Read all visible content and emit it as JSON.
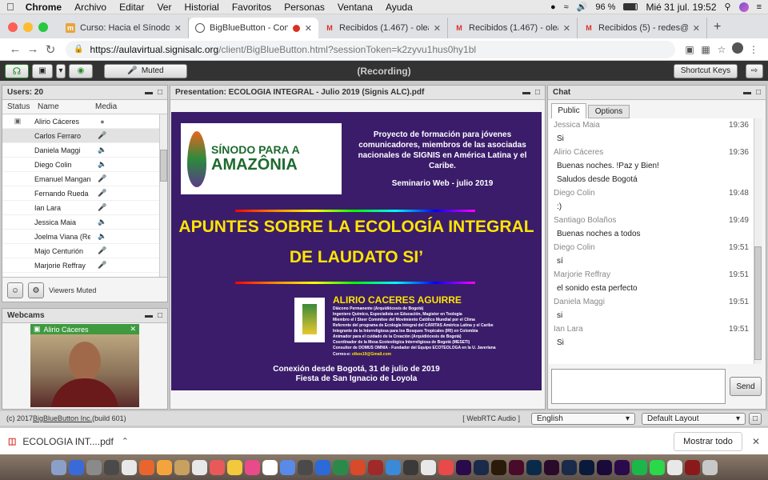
{
  "macmenu": {
    "app": "Chrome",
    "items": [
      "Archivo",
      "Editar",
      "Ver",
      "Historial",
      "Favoritos",
      "Personas",
      "Ventana",
      "Ayuda"
    ],
    "battery": "96 %",
    "clock": "Mié 31 jul.  19:52"
  },
  "tabs": [
    {
      "label": "Curso: Hacia el Sínodo Pana",
      "icon_color": "#e8a43c",
      "icon": "course-icon",
      "active": false
    },
    {
      "label": "BigBlueButton - Confere",
      "icon_color": "#555555",
      "icon": "globe-icon",
      "active": true,
      "recording": true
    },
    {
      "label": "Recibidos (1.467) - oleasc@",
      "icon_color": "#d93025",
      "icon": "gmail-icon",
      "active": false
    },
    {
      "label": "Recibidos (1.467) - oleasc@",
      "icon_color": "#d93025",
      "icon": "gmail-icon",
      "active": false
    },
    {
      "label": "Recibidos (5) - redes@signi",
      "icon_color": "#d93025",
      "icon": "gmail-icon",
      "active": false
    }
  ],
  "address": {
    "host": "https://aulavirtual.signisalc.org",
    "path": "/client/BigBlueButton.html?sessionToken=k2zyvu1hus0hy1bl"
  },
  "toolbar": {
    "muted_label": "Muted",
    "recording": "(Recording)",
    "shortcut_keys": "Shortcut Keys"
  },
  "users": {
    "title": "Users: 20",
    "columns": [
      "Status",
      "Name",
      "Media"
    ],
    "list": [
      {
        "name": "Alirio Cáceres",
        "media": "webcam",
        "selected": false,
        "presenter": true
      },
      {
        "name": "Carlos Ferraro",
        "media": "mic-off",
        "selected": true
      },
      {
        "name": "Daniela Maggi",
        "media": "speaker"
      },
      {
        "name": "Diego Colin",
        "media": "speaker"
      },
      {
        "name": "Emanuel Mangane",
        "media": "mic-off"
      },
      {
        "name": "Fernando Rueda",
        "media": "mic-off"
      },
      {
        "name": "Ian Lara",
        "media": "mic-off"
      },
      {
        "name": "Jessica Maia",
        "media": "speaker"
      },
      {
        "name": "Joelma Viana (Rec",
        "media": "speaker"
      },
      {
        "name": "Majo Centurión",
        "media": "mic-off"
      },
      {
        "name": "Marjorie Reffray",
        "media": "mic-off"
      }
    ],
    "viewers_muted": "Viewers Muted"
  },
  "webcams": {
    "title": "Webcams",
    "cam_name": "Alirio Cáceres"
  },
  "presentation": {
    "title": "Presentation: ECOLOGIA INTEGRAL - Julio 2019 (Signis ALC).pdf",
    "slide": {
      "logo_line1": "SÍNODO PARA A",
      "logo_line2": "AMAZÔNIA",
      "project_text": "Proyecto de formación para jóvenes comunicadores, miembros de las asociadas nacionales de SIGNIS en América Latina y el Caribe.",
      "seminar": "Seminario Web - julio 2019",
      "headline1": "APUNTES SOBRE LA ECOLOGÍA INTEGRAL",
      "headline2": "DE LAUDATO SI’",
      "author": "ALIRIO CACERES AGUIRRE",
      "bio": [
        "Diácono Permanente (Arquidiócesis de Bogotá)",
        "Ingeniero Químico, Especialista en Educación,  Magister en Teología",
        "Miembro el I Steer Commitee del Movimiento Católico Mundial por el Clima",
        "Referente del programa de Ecología Integral del CÁRITAS América Latina y el Caribe",
        "Integrante de la Interreligiosa para los Bosques Tropicales (IRI) en Colombia",
        "Animador para el cuidado de la Creación (Arquidiócesis de Bogotá)",
        "Coordinador de la Mesa Ecoteológica Interreligiosa de Bogotá (MESETI)",
        "Consultor de DOMUS OMNIA - Fundador del Equipo ECOTEOLOGA  en la  U. Javeriana"
      ],
      "email_label": "Correo-e: ",
      "email": "olkos19@Gmail.com",
      "connection": "Conexión desde Bogotá, 31 de julio de 2019",
      "feast": "Fiesta de San Ignacio de Loyola"
    }
  },
  "chat": {
    "title": "Chat",
    "tabs": [
      "Public",
      "Options"
    ],
    "messages": [
      {
        "name": "Jessica Maia",
        "time": "19:36",
        "lines": [
          "Si"
        ],
        "partial": true
      },
      {
        "name": "Alirio Cáceres",
        "time": "19:36",
        "lines": [
          "Buenas noches. !Paz y Bien!",
          "Saludos desde Bogotá"
        ]
      },
      {
        "name": "Diego Colin",
        "time": "19:48",
        "lines": [
          ":)"
        ]
      },
      {
        "name": "Santiago Bolaños",
        "time": "19:49",
        "lines": [
          "Buenas noches a todos"
        ]
      },
      {
        "name": "Diego Colin",
        "time": "19:51",
        "lines": [
          "sí"
        ]
      },
      {
        "name": "Marjorie Reffray",
        "time": "19:51",
        "lines": [
          "el sonido esta perfecto"
        ]
      },
      {
        "name": "Daniela Maggi",
        "time": "19:51",
        "lines": [
          "si"
        ]
      },
      {
        "name": "Ian Lara",
        "time": "19:51",
        "lines": [
          "Si"
        ]
      }
    ],
    "send": "Send"
  },
  "footer": {
    "copyright": "(c) 2017 ",
    "link": "BigBlueButton Inc.",
    "build": " (build 601)",
    "webrtc": "[ WebRTC Audio ]",
    "language": "English",
    "layout": "Default Layout"
  },
  "download": {
    "file": "ECOLOGIA INT....pdf",
    "show_all": "Mostrar todo"
  },
  "colors": {
    "toolbar": "#333333",
    "slide_bg": "#3a1c6a",
    "headline": "#ffe500",
    "author": "#ffe500"
  }
}
